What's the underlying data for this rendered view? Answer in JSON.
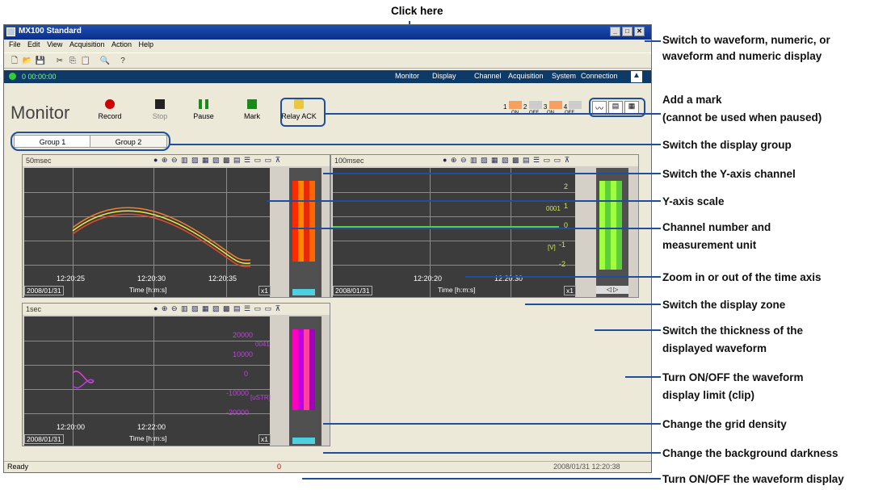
{
  "header_label": "Click here",
  "window": {
    "title": "MX100 Standard",
    "menu": [
      "File",
      "Edit",
      "View",
      "Acquisition",
      "Action",
      "Help"
    ],
    "elapsed": "0 00:00:00",
    "tabs": [
      "Monitor",
      "Display",
      "Channel",
      "Acquisition",
      "System",
      "Connection"
    ]
  },
  "monitor": {
    "title": "Monitor",
    "controls": [
      "Record",
      "Stop",
      "Pause",
      "Mark"
    ],
    "relay": "Relay ACK",
    "alarms": [
      {
        "num": "1",
        "state": "ON"
      },
      {
        "num": "2",
        "state": "OFF"
      },
      {
        "num": "3",
        "state": "ON"
      },
      {
        "num": "4",
        "state": "OFF"
      }
    ],
    "groups": [
      "Group 1",
      "Group 2"
    ]
  },
  "panels": {
    "p1": {
      "interval": "50msec",
      "ticks": [
        "12:20:25",
        "12:20:30",
        "12:20:35"
      ],
      "date": "2008/01/31",
      "xlabel": "Time [h:m:s]",
      "zoom": "x1"
    },
    "p2": {
      "interval": "100msec",
      "ticks": [
        "12:20:20",
        "12:20:30"
      ],
      "date": "2008/01/31",
      "xlabel": "Time [h:m:s]",
      "zoom": "x1",
      "yticks": [
        "2",
        "1",
        "0",
        "-1",
        "-2"
      ],
      "ychan": "0001",
      "yunit": "[V]"
    },
    "p3": {
      "interval": "1sec",
      "ticks": [
        "12:20:00",
        "12:22:00"
      ],
      "date": "2008/01/31",
      "xlabel": "Time [h:m:s]",
      "zoom": "x1",
      "yticks": [
        "20000",
        "10000",
        "0",
        "-10000",
        "-20000"
      ],
      "ychan": "0041",
      "yunit": "[uSTR]"
    }
  },
  "statusbar": {
    "text": "Ready",
    "count": "0",
    "datetime": "2008/01/31 12:20:38"
  },
  "callouts": [
    "Switch to waveform, numeric, or",
    "waveform and numeric display",
    "Add a mark",
    "(cannot be used when paused)",
    "Switch the display group",
    "Switch the Y-axis channel",
    "Y-axis scale",
    "Channel number and",
    "measurement unit",
    "Zoom in or out of the time axis",
    "Switch the display zone",
    "Switch the thickness of the",
    "displayed waveform",
    "Turn ON/OFF the waveform",
    "display limit (clip)",
    "Change the grid density",
    "Change the background darkness",
    "Turn ON/OFF the waveform display"
  ],
  "colors": {
    "accent": "#1f4e9c",
    "plot_bg": "#3c3c3c",
    "title_blue": "#0a2f8c"
  }
}
